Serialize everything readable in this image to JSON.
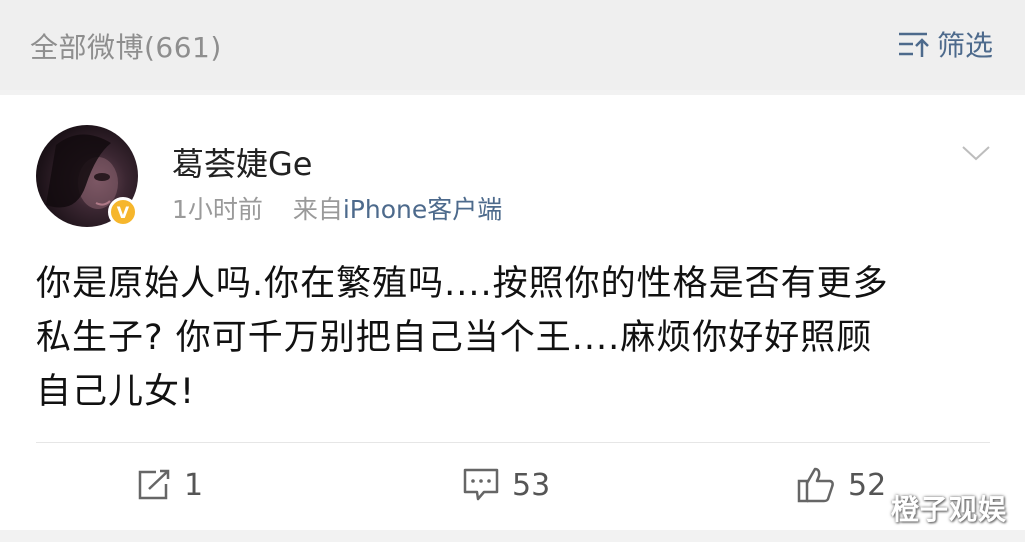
{
  "header": {
    "title": "全部微博(661)",
    "filter_label": "筛选",
    "filter_icon": "filter-sort-icon"
  },
  "post": {
    "username": "葛荟婕Ge",
    "time": "1小时前",
    "source_prefix": "来自",
    "source": "iPhone客户端",
    "text_lines": [
      "你是原始人吗.你在繁殖吗....按照你的性格是否有更多",
      "私生子? 你可千万别把自己当个王....麻烦你好好照顾",
      "自己儿女!"
    ],
    "verified_badge": "V"
  },
  "actions": {
    "repost": {
      "icon": "repost-icon",
      "count": "1"
    },
    "comment": {
      "icon": "comment-icon",
      "count": "53"
    },
    "like": {
      "icon": "thumbs-up-icon",
      "count": "52"
    }
  },
  "watermark": "橙子观娱",
  "colors": {
    "link_blue": "#4d6a8c",
    "verify_gold": "#f6b62c",
    "muted_gray": "#9a9a9a"
  }
}
